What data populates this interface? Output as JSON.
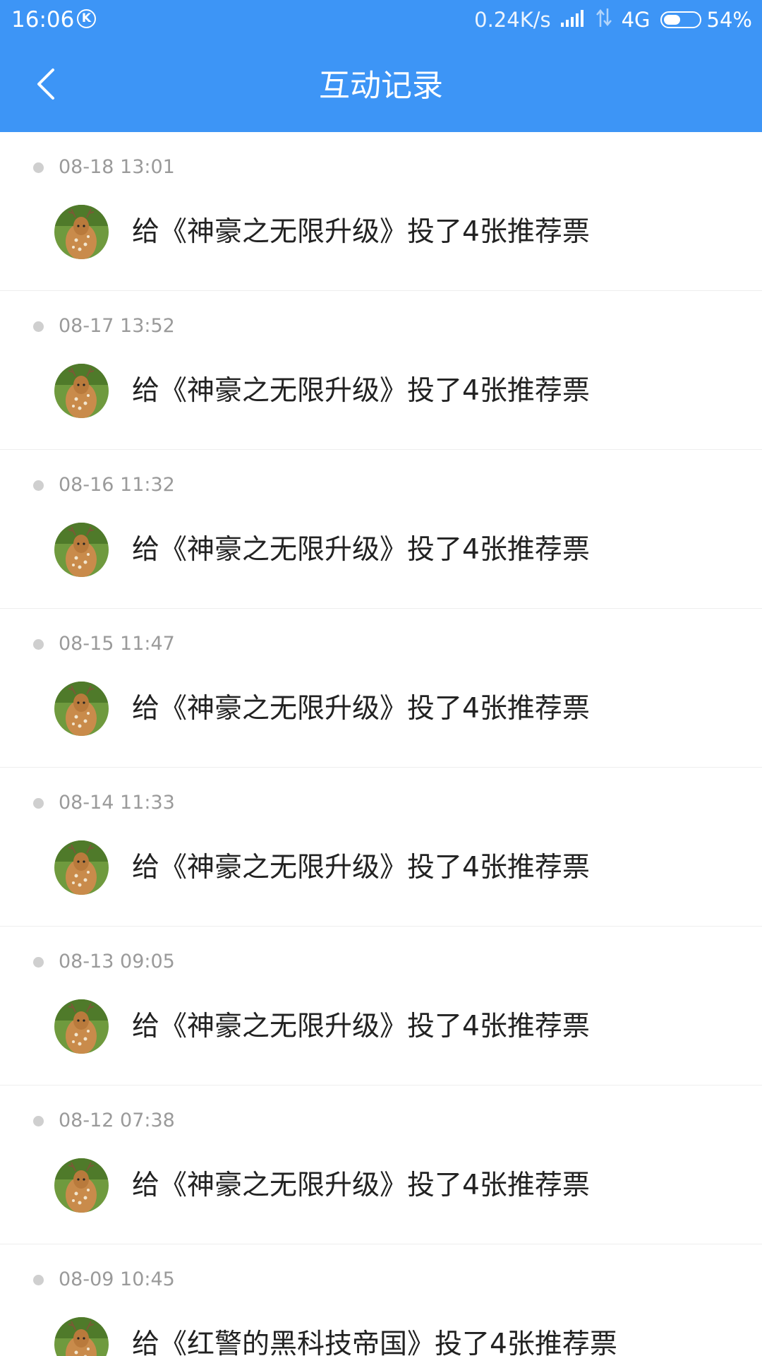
{
  "status_bar": {
    "time": "16:06",
    "app_badge": "K",
    "net_speed": "0.24K/s",
    "network": "4G",
    "battery_percent": "54%",
    "battery_level": 0.54
  },
  "header": {
    "title": "互动记录",
    "back_icon": "chevron-left-icon"
  },
  "records": [
    {
      "time": "08-18 13:01",
      "text": "给《神豪之无限升级》投了4张推荐票"
    },
    {
      "time": "08-17 13:52",
      "text": "给《神豪之无限升级》投了4张推荐票"
    },
    {
      "time": "08-16 11:32",
      "text": "给《神豪之无限升级》投了4张推荐票"
    },
    {
      "time": "08-15 11:47",
      "text": "给《神豪之无限升级》投了4张推荐票"
    },
    {
      "time": "08-14 11:33",
      "text": "给《神豪之无限升级》投了4张推荐票"
    },
    {
      "time": "08-13 09:05",
      "text": "给《神豪之无限升级》投了4张推荐票"
    },
    {
      "time": "08-12 07:38",
      "text": "给《神豪之无限升级》投了4张推荐票"
    },
    {
      "time": "08-09 10:45",
      "text": "给《红警的黑科技帝国》投了4张推荐票"
    }
  ],
  "colors": {
    "accent": "#3d95f6",
    "text_primary": "#222222",
    "text_secondary": "#9a9a9a",
    "divider": "#eeeeee"
  }
}
